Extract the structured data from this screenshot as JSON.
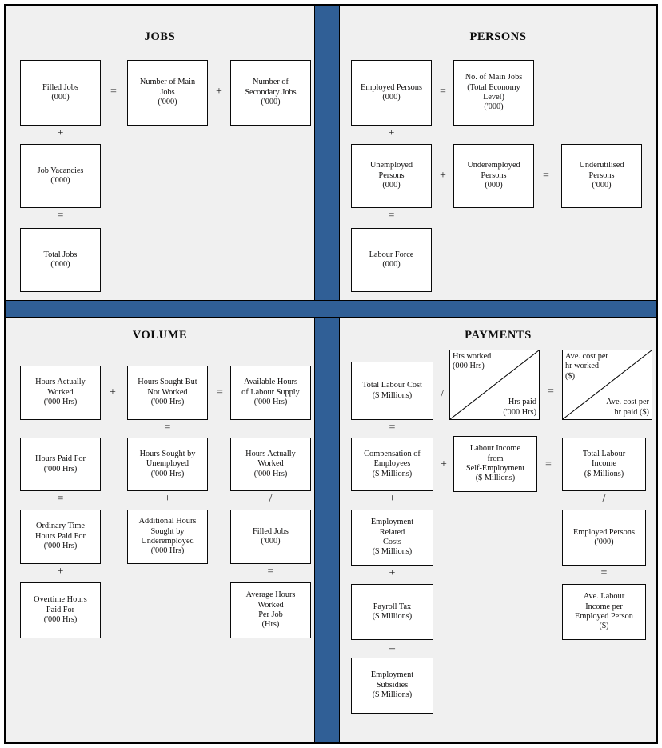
{
  "colors": {
    "divider_blue": "#305f96",
    "panel_background": "#f0f0f0",
    "box_fill": "#ffffff",
    "border": "#0a0a0a"
  },
  "quadrants": {
    "jobs": {
      "title": "JOBS",
      "boxes": {
        "filled_jobs": "Filled Jobs\n(000)",
        "number_of_main_jobs": "Number of Main\nJobs\n('000)",
        "number_of_secondary_jobs": "Number of\nSecondary Jobs\n('000)",
        "job_vacancies": "Job Vacancies\n('000)",
        "total_jobs": "Total Jobs\n('000)"
      },
      "operators": {
        "eq_filled": "=",
        "plus_main_secondary": "+",
        "plus_filled_vacancies": "+",
        "eq_total": "="
      }
    },
    "persons": {
      "title": "PERSONS",
      "boxes": {
        "employed_persons": "Employed Persons\n(000)",
        "no_of_main_jobs_total_economy": "No. of Main Jobs\n(Total Economy\nLevel)\n('000)",
        "unemployed_persons": "Unemployed\nPersons\n(000)",
        "underemployed_persons": "Underemployed\nPersons\n(000)",
        "underutilised_persons": "Underutilised\nPersons\n('000)",
        "labour_force": "Labour Force\n(000)"
      },
      "operators": {
        "eq_employed": "=",
        "plus_employed_unemployed": "+",
        "plus_unemp_underemp": "+",
        "eq_underutilised": "=",
        "eq_labour_force": "="
      }
    },
    "volume": {
      "title": "VOLUME",
      "boxes": {
        "hours_actually_worked": "Hours Actually\nWorked\n('000 Hrs)",
        "hours_sought_but_not_worked": "Hours Sought But\nNot Worked\n('000 Hrs)",
        "available_hours_of_labour_supply": "Available Hours\nof Labour Supply\n('000 Hrs)",
        "hours_paid_for": "Hours Paid For\n('000 Hrs)",
        "hours_sought_by_unemployed": "Hours Sought by\nUnemployed\n('000 Hrs)",
        "hours_actually_worked_2": "Hours Actually\nWorked\n('000 Hrs)",
        "ordinary_time_hours_paid_for": "Ordinary Time\nHours Paid For\n('000 Hrs)",
        "additional_hours_sought_by_underemployed": "Additional Hours\nSought by\nUnderemployed\n('000 Hrs)",
        "filled_jobs": "Filled Jobs\n('000)",
        "overtime_hours_paid_for": "Overtime Hours\nPaid For\n('000 Hrs)",
        "average_hours_worked_per_job": "Average Hours\nWorked\nPer Job\n(Hrs)"
      },
      "operators": {
        "plus_r1": "+",
        "eq_r1": "=",
        "eq_c2_r1r2": "=",
        "eq_c1_r1r2": "=",
        "plus_c2_r2r3": "+",
        "div_c3_r2r3": "/",
        "plus_c1_r3r4": "+",
        "eq_c3_r3r4": "="
      }
    },
    "payments": {
      "title": "PAYMENTS",
      "boxes": {
        "total_labour_cost": "Total Labour Cost\n($ Millions)",
        "compensation_of_employees": "Compensation of\nEmployees\n($ Millions)",
        "labour_income_from_self_employment": "Labour Income\nfrom\nSelf-Employment\n($ Millions)",
        "total_labour_income": "Total Labour\nIncome\n($ Millions)",
        "employment_related_costs": "Employment\nRelated\nCosts\n($ Millions)",
        "employed_persons": "Employed Persons\n('000)",
        "payroll_tax": "Payroll Tax\n($ Millions)",
        "ave_labour_income_per_employed_person": "Ave. Labour\nIncome per\nEmployed Person\n($)",
        "employment_subsidies": "Employment\nSubsidies\n($ Millions)"
      },
      "split_boxes": {
        "hours": {
          "top_left": "Hrs worked\n(000 Hrs)",
          "bottom_right": "Hrs paid\n('000 Hrs)"
        },
        "ave_cost": {
          "top_left": "Ave. cost per\nhr worked\n($)",
          "bottom_right": "Ave. cost per\nhr paid ($)"
        }
      },
      "operators": {
        "div_cost_hours": "/",
        "eq_hours_cost": "=",
        "eq_c1_r1r2": "=",
        "plus_comp_self": "+",
        "eq_total_income": "=",
        "plus_c1_r2r3": "+",
        "div_c3_r2r3": "/",
        "plus_c1_r3r4": "+",
        "eq_c3_r3r4": "=",
        "minus_c1_r4r5": "–"
      }
    }
  }
}
